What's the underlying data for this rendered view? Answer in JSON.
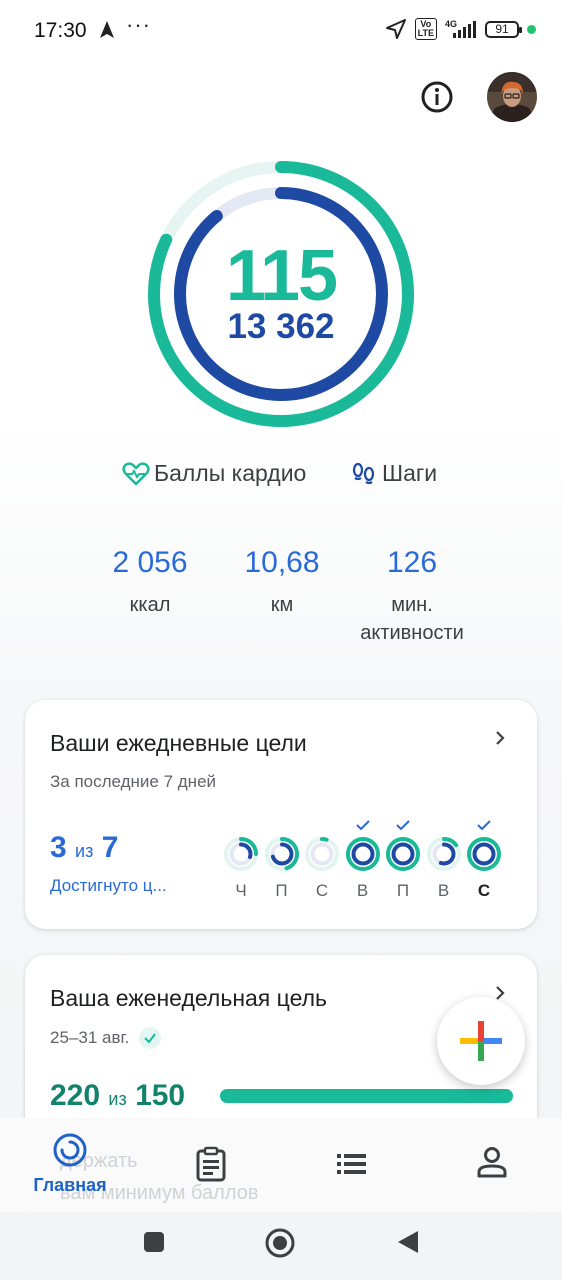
{
  "status_bar": {
    "time": "17:30",
    "dots": "···",
    "network": "4G",
    "volte": "Vo LTE",
    "battery": "91",
    "icons": [
      "navigation-arrow-icon",
      "location-icon",
      "signal-icon",
      "battery-icon"
    ]
  },
  "header": {
    "info_icon": "info-icon",
    "avatar": "user-avatar"
  },
  "rings": {
    "cardio_points": "115",
    "steps": "13 362",
    "cardio_color": "#1ab99a",
    "steps_color": "#1f4aa3",
    "cardio_progress": 0.82,
    "steps_progress": 0.89
  },
  "legend": {
    "cardio_label": "Баллы кардио",
    "steps_label": "Шаги"
  },
  "stats": [
    {
      "value": "2 056",
      "label": "ккал"
    },
    {
      "value": "10,68",
      "label": "км"
    },
    {
      "value": "126",
      "label": "мин.",
      "label2": "активности"
    }
  ],
  "daily_goals": {
    "title": "Ваши ежедневные цели",
    "subtitle": "За последние 7 дней",
    "count": "3",
    "of": "из",
    "total": "7",
    "achieved_label": "Достигнуто ц...",
    "days": [
      {
        "label": "Ч",
        "achieved": false,
        "outer": 0.25,
        "inner": 0.3
      },
      {
        "label": "П",
        "achieved": false,
        "outer": 0.45,
        "inner": 0.7
      },
      {
        "label": "С",
        "achieved": false,
        "outer": 0.05,
        "inner": 0.0
      },
      {
        "label": "В",
        "achieved": true,
        "outer": 1.0,
        "inner": 1.0
      },
      {
        "label": "П",
        "achieved": true,
        "outer": 1.0,
        "inner": 1.0
      },
      {
        "label": "В",
        "achieved": false,
        "outer": 0.15,
        "inner": 0.55
      },
      {
        "label": "С",
        "achieved": true,
        "outer": 1.0,
        "inner": 1.0,
        "today": true
      }
    ]
  },
  "weekly_goal": {
    "title": "Ваша еженедельная цель",
    "range": "25–31 авг.",
    "value": "220",
    "of": "из",
    "target": "150",
    "progress": 1.0
  },
  "ghost": {
    "line1": "держать",
    "line2": "вам минимум баллов"
  },
  "bottom_nav": [
    {
      "label": "Главная",
      "icon": "home-rings-icon",
      "active": true
    },
    {
      "label": "",
      "icon": "journal-icon",
      "active": false
    },
    {
      "label": "",
      "icon": "browse-list-icon",
      "active": false
    },
    {
      "label": "",
      "icon": "profile-icon",
      "active": false
    }
  ],
  "system_nav": [
    "recents-square-icon",
    "home-circle-icon",
    "back-triangle-icon"
  ]
}
